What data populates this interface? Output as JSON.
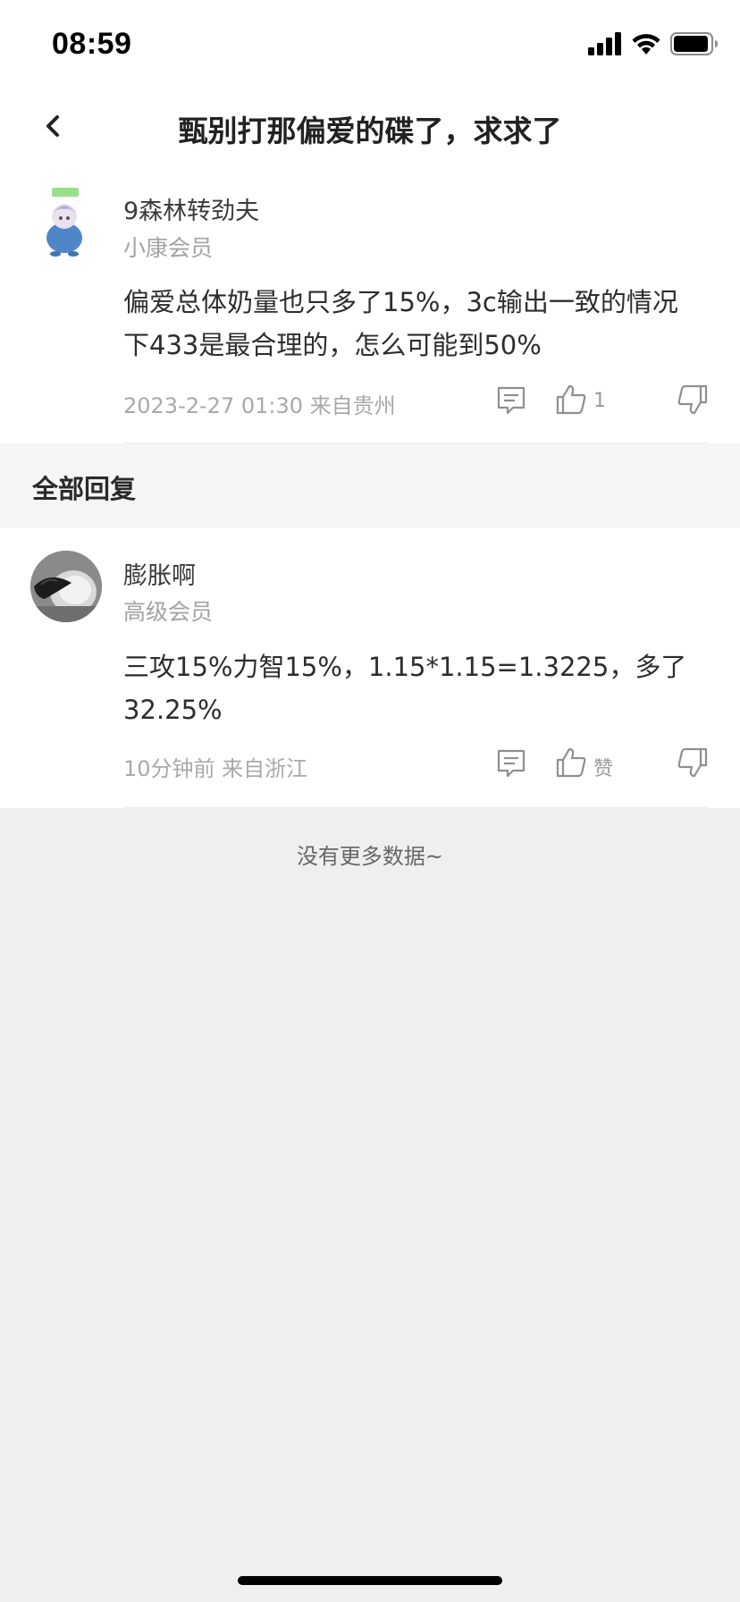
{
  "status_bar": {
    "time": "08:59",
    "icons": [
      "signal-icon",
      "wifi-icon",
      "battery-icon"
    ]
  },
  "nav": {
    "title": "甄别打那偏爱的碟了，求求了",
    "back_icon": "chevron-left-icon"
  },
  "post": {
    "user_name": "9森林转劲夫",
    "user_level": "小康会员",
    "content": "偏爱总体奶量也只多了15%，3c输出一致的情况下433是最合理的，怎么可能到50%",
    "meta": "2023-2-27 01:30  来自贵州",
    "like_count": "1"
  },
  "section": {
    "title": "全部回复"
  },
  "replies": [
    {
      "user_name": "膨胀啊",
      "user_level": "高级会员",
      "content": "三攻15%力智15%，1.15*1.15=1.3225，多了32.25%",
      "meta": "10分钟前 来自浙江",
      "like_label": "赞"
    }
  ],
  "footer": {
    "no_more": "没有更多数据~"
  },
  "colors": {
    "page_bg": "#efefef",
    "card_bg": "#ffffff",
    "section_bg": "#f5f5f5",
    "muted_text": "#a9a9a9",
    "primary_text": "#2d2d2d"
  }
}
